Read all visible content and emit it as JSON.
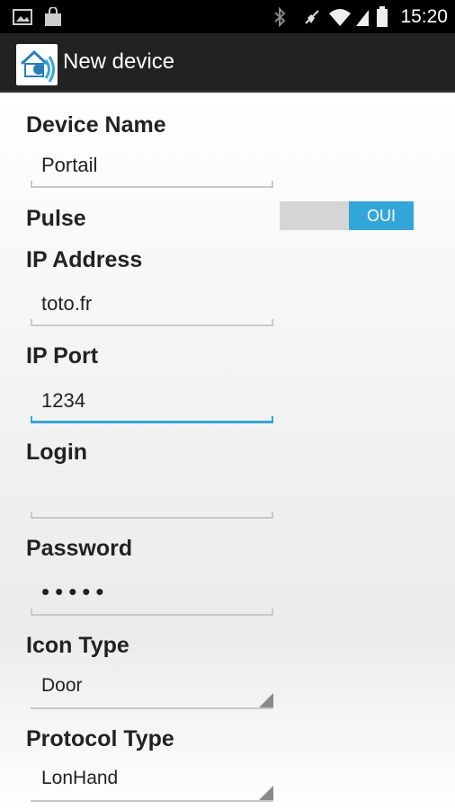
{
  "status_bar": {
    "time": "15:20",
    "icons": [
      "image-icon",
      "shop-bag-icon",
      "bluetooth-icon",
      "mute-icon",
      "wifi-icon",
      "signal-icon",
      "battery-icon"
    ]
  },
  "action_bar": {
    "title": "New device",
    "app_icon": "home-wireless-app-icon"
  },
  "form": {
    "device_name": {
      "label": "Device Name",
      "value": "Portail"
    },
    "pulse": {
      "label": "Pulse",
      "toggle_text": "OUI",
      "on": true
    },
    "ip_address": {
      "label": "IP Address",
      "value": "toto.fr"
    },
    "ip_port": {
      "label": "IP Port",
      "value": "1234"
    },
    "login": {
      "label": "Login",
      "value": ""
    },
    "password": {
      "label": "Password",
      "masked_value": "•••••"
    },
    "icon_type": {
      "label": "Icon Type",
      "selected": "Door"
    },
    "protocol_type": {
      "label": "Protocol Type",
      "selected": "LonHand"
    }
  },
  "colors": {
    "accent": "#33a6d9",
    "status_bar": "#000000",
    "action_bar": "#222222"
  }
}
